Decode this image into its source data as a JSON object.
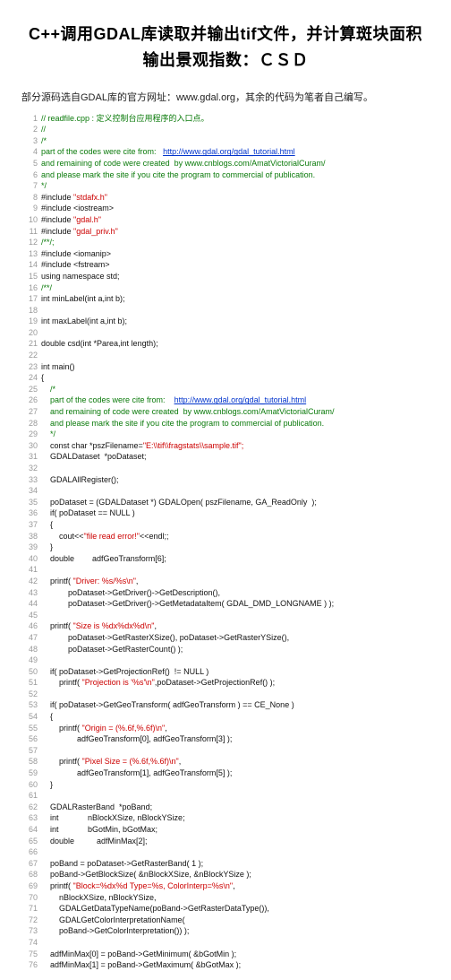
{
  "title": "C++调用GDAL库读取并输出tif文件，并计算斑块面积输出景观指数：ＣＳＤ",
  "intro": "部分源码选自GDAL库的官方网址：www.gdal.org，其余的代码为笔者自己编写。",
  "lines": [
    {
      "c": "g",
      "t": "// readfile.cpp : 定义控制台应用程序的入口点。"
    },
    {
      "c": "g",
      "t": "//"
    },
    {
      "c": "g",
      "t": "/*"
    },
    {
      "c": "g",
      "t": "part of the codes were cite from:   ",
      "lnk": "http://www.gdal.org/gdal_tutorial.html"
    },
    {
      "c": "g",
      "t": "and remaining of code were created  by www.cnblogs.com/AmatVictorialCuram/"
    },
    {
      "c": "g",
      "t": "and please mark the site if you cite the program to commercial of publication."
    },
    {
      "c": "g",
      "t": "*/"
    },
    {
      "c": "bl",
      "t": "#include ",
      "s": "\"stdafx.h\""
    },
    {
      "c": "bl",
      "t": "#include <iostream>"
    },
    {
      "c": "bl",
      "t": "#include ",
      "s": "\"gdal.h\""
    },
    {
      "c": "bl",
      "t": "#include ",
      "s": "\"gdal_priv.h\""
    },
    {
      "c": "g",
      "t": "/**/;"
    },
    {
      "c": "bl",
      "t": "#include <iomanip>"
    },
    {
      "c": "bl",
      "t": "#include <fstream>"
    },
    {
      "c": "bl",
      "t": "using namespace std;"
    },
    {
      "c": "g",
      "t": "/**/"
    },
    {
      "c": "bl",
      "t": "int minLabel(int a,int b);"
    },
    {
      "c": "bl",
      "t": ""
    },
    {
      "c": "bl",
      "t": "int maxLabel(int a,int b);"
    },
    {
      "c": "bl",
      "t": ""
    },
    {
      "c": "bl",
      "t": "double csd(int *Parea,int length);"
    },
    {
      "c": "bl",
      "t": ""
    },
    {
      "c": "bl",
      "t": "int main()"
    },
    {
      "c": "bl",
      "t": "{"
    },
    {
      "c": "g",
      "t": "    /*"
    },
    {
      "c": "g",
      "t": "    part of the codes were cite from:    ",
      "lnk": "http://www.gdal.org/gdal_tutorial.html"
    },
    {
      "c": "g",
      "t": "    and remaining of code were created  by www.cnblogs.com/AmatVictorialCuram/"
    },
    {
      "c": "g",
      "t": "    and please mark the site if you cite the program to commercial of publication."
    },
    {
      "c": "g",
      "t": "    */"
    },
    {
      "c": "bl",
      "t": "    const char *pszFilename=",
      "s": "\"E:\\\\tif\\\\fragstats\\\\sample.tif\";"
    },
    {
      "c": "bl",
      "t": "    GDALDataset  *poDataset;"
    },
    {
      "c": "bl",
      "t": ""
    },
    {
      "c": "bl",
      "t": "    GDALAllRegister();"
    },
    {
      "c": "bl",
      "t": ""
    },
    {
      "c": "bl",
      "t": "    poDataset = (GDALDataset *) GDALOpen( pszFilename, GA_ReadOnly  );"
    },
    {
      "c": "bl",
      "t": "    if( poDataset == NULL )"
    },
    {
      "c": "bl",
      "t": "    {"
    },
    {
      "c": "bl",
      "t": "        cout<<",
      "s": "\"file read error!\"",
      "t2": "<<endl;;"
    },
    {
      "c": "bl",
      "t": "    }"
    },
    {
      "c": "bl",
      "t": "    double        adfGeoTransform[6];"
    },
    {
      "c": "bl",
      "t": ""
    },
    {
      "c": "bl",
      "t": "    printf( ",
      "s": "\"Driver: %s/%s\\n\"",
      "t2": ","
    },
    {
      "c": "bl",
      "t": "            poDataset->GetDriver()->GetDescription(), "
    },
    {
      "c": "bl",
      "t": "            poDataset->GetDriver()->GetMetadataItem( GDAL_DMD_LONGNAME ) );"
    },
    {
      "c": "bl",
      "t": ""
    },
    {
      "c": "bl",
      "t": "    printf( ",
      "s": "\"Size is %dx%dx%d\\n\"",
      "t2": ", "
    },
    {
      "c": "bl",
      "t": "            poDataset->GetRasterXSize(), poDataset->GetRasterYSize(),"
    },
    {
      "c": "bl",
      "t": "            poDataset->GetRasterCount() );"
    },
    {
      "c": "bl",
      "t": ""
    },
    {
      "c": "bl",
      "t": "    if( poDataset->GetProjectionRef()  != NULL )"
    },
    {
      "c": "bl",
      "t": "        printf( ",
      "s": "\"Projection is '%s'\\n\"",
      "t2": ",poDataset->GetProjectionRef() );"
    },
    {
      "c": "bl",
      "t": ""
    },
    {
      "c": "bl",
      "t": "    if( poDataset->GetGeoTransform( adfGeoTransform ) == CE_None )"
    },
    {
      "c": "bl",
      "t": "    {"
    },
    {
      "c": "bl",
      "t": "        printf( ",
      "s": "\"Origin = (%.6f,%.6f)\\n\"",
      "t2": ","
    },
    {
      "c": "bl",
      "t": "                adfGeoTransform[0], adfGeoTransform[3] );"
    },
    {
      "c": "bl",
      "t": ""
    },
    {
      "c": "bl",
      "t": "        printf( ",
      "s": "\"Pixel Size = (%.6f,%.6f)\\n\"",
      "t2": ","
    },
    {
      "c": "bl",
      "t": "                adfGeoTransform[1], adfGeoTransform[5] );"
    },
    {
      "c": "bl",
      "t": "    }"
    },
    {
      "c": "bl",
      "t": ""
    },
    {
      "c": "bl",
      "t": "    GDALRasterBand  *poBand;"
    },
    {
      "c": "bl",
      "t": "    int             nBlockXSize, nBlockYSize;"
    },
    {
      "c": "bl",
      "t": "    int             bGotMin, bGotMax;"
    },
    {
      "c": "bl",
      "t": "    double          adfMinMax[2];"
    },
    {
      "c": "bl",
      "t": ""
    },
    {
      "c": "bl",
      "t": "    poBand = poDataset->GetRasterBand( 1 );"
    },
    {
      "c": "bl",
      "t": "    poBand->GetBlockSize( &nBlockXSize, &nBlockYSize );"
    },
    {
      "c": "bl",
      "t": "    printf( ",
      "s": "\"Block=%dx%d Type=%s, ColorInterp=%s\\n\"",
      "t2": ","
    },
    {
      "c": "bl",
      "t": "        nBlockXSize, nBlockYSize,"
    },
    {
      "c": "bl",
      "t": "        GDALGetDataTypeName(poBand->GetRasterDataType()),"
    },
    {
      "c": "bl",
      "t": "        GDALGetColorInterpretationName("
    },
    {
      "c": "bl",
      "t": "        poBand->GetColorInterpretation()) );"
    },
    {
      "c": "bl",
      "t": ""
    },
    {
      "c": "bl",
      "t": "    adfMinMax[0] = poBand->GetMinimum( &bGotMin );"
    },
    {
      "c": "bl",
      "t": "    adfMinMax[1] = poBand->GetMaximum( &bGotMax );"
    }
  ]
}
